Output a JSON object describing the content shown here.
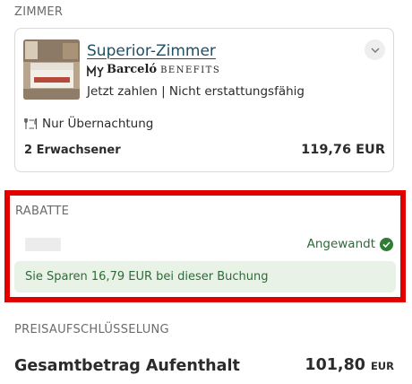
{
  "room_section": {
    "label": "ZIMMER",
    "room_name": "Superior-Zimmer",
    "brand_logo": "MyBarceló",
    "brand_name": "Barceló",
    "brand_sub": "BENEFITS",
    "rate_conditions": "Jetzt zahlen | Nicht erstattungsfähig",
    "meal_icon": "cutlery-icon",
    "meal_plan": "Nur Übernachtung",
    "guests": "2 Erwachsener",
    "price": "119,76 EUR"
  },
  "discount_section": {
    "label": "RABATTE",
    "status": "Angewandt",
    "status_icon": "check-circle-icon",
    "savings_message": "Sie Sparen 16,79 EUR bei dieser Buchung"
  },
  "breakdown_section": {
    "label": "PREISAUFSCHLÜSSELUNG",
    "total_label": "Gesamtbetrag Aufenthalt",
    "total_amount": "101,80",
    "total_currency": "EUR"
  },
  "colors": {
    "title_link": "#1f4f66",
    "success_green": "#2e7d32",
    "success_bg": "#e9f2e6",
    "highlight_red": "#e00000"
  }
}
